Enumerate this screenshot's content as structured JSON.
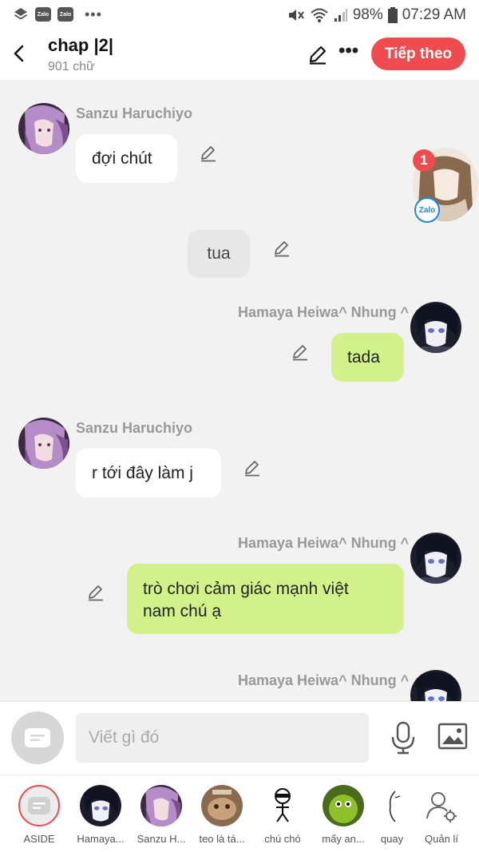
{
  "status_bar": {
    "app_icons": [
      "layers-icon",
      "zalo-icon",
      "zalo-icon"
    ],
    "zalo_text": "Zalo",
    "more": "•••",
    "battery": "98%",
    "time": "07:29 AM"
  },
  "header": {
    "title": "chap |2|",
    "subtitle": "901 chữ",
    "next_button": "Tiếp theo",
    "more": "•••"
  },
  "messages": [
    {
      "sender": "Sanzu Haruchiyo",
      "text": "đợi chút",
      "side": "left"
    },
    {
      "sender": "",
      "text": "tua",
      "side": "center"
    },
    {
      "sender": "Hamaya Heiwa^ Nhung ^",
      "text": "tada",
      "side": "right"
    },
    {
      "sender": "Sanzu Haruchiyo",
      "text": "r tới đây làm j",
      "side": "left"
    },
    {
      "sender": "Hamaya Heiwa^ Nhung ^",
      "text_line1": "trò chơi cảm giác mạnh việt",
      "text_line2": "nam chú ạ",
      "side": "right"
    },
    {
      "sender": "Hamaya Heiwa^ Nhung ^",
      "side": "right"
    }
  ],
  "floating_chat_head": {
    "badge": "1",
    "app": "Zalo"
  },
  "composer": {
    "placeholder": "Viết gì đó"
  },
  "cast": [
    {
      "label": "ASIDE"
    },
    {
      "label": "Hamaya..."
    },
    {
      "label": "Sanzu H..."
    },
    {
      "label": "teo là tá..."
    },
    {
      "label": "chú chó"
    },
    {
      "label": "mấy an..."
    },
    {
      "label": "quay"
    },
    {
      "label": "Quản lí"
    }
  ],
  "colors": {
    "accent": "#f04b4e",
    "bubble_green": "#d2f18a",
    "bubble_white": "#ffffff",
    "bubble_grey": "#e7e7e7",
    "background": "#f2f2f2"
  }
}
